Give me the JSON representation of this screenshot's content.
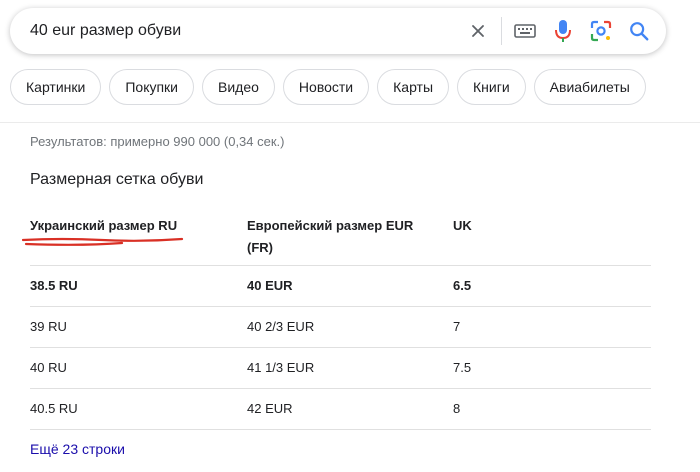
{
  "search": {
    "value": "40 eur размер обуви"
  },
  "chips": [
    "Картинки",
    "Покупки",
    "Видео",
    "Новости",
    "Карты",
    "Книги",
    "Авиабилеты"
  ],
  "results": {
    "stats": "Результатов: примерно 990 000 (0,34 сек.)"
  },
  "size_chart": {
    "title": "Размерная сетка обуви",
    "headers": {
      "ru": "Украинский размер RU",
      "eur": "Европейский размер EUR (FR)",
      "uk": "UK"
    },
    "rows": [
      {
        "ru": "38.5 RU",
        "eur": "40 EUR",
        "uk": "6.5"
      },
      {
        "ru": "39 RU",
        "eur": "40 2/3 EUR",
        "uk": "7"
      },
      {
        "ru": "40 RU",
        "eur": "41 1/3 EUR",
        "uk": "7.5"
      },
      {
        "ru": "40.5 RU",
        "eur": "42 EUR",
        "uk": "8"
      }
    ],
    "more_link": "Ещё 23 строки"
  },
  "colors": {
    "link": "#1a0dab",
    "annotation": "#d93025",
    "mic_blue": "#4285f4",
    "mic_red": "#ea4335"
  }
}
